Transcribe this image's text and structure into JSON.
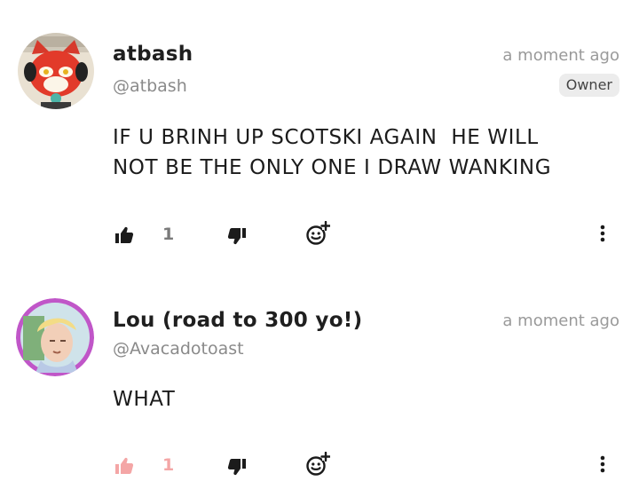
{
  "comments": [
    {
      "author": "atbash",
      "handle": "@atbash",
      "time": "a moment ago",
      "badge": "Owner",
      "text": "IF U BRINH UP SCOTSKI AGAIN  HE WILL\nNOT BE THE ONLY ONE I DRAW WANKING",
      "likes": "1",
      "liked": false,
      "avatar_icon": "red-cat-avatar"
    },
    {
      "author": "Lou (road to 300 yo!)",
      "handle": "@Avacadotoast",
      "time": "a moment ago",
      "text": "WHAT",
      "likes": "1",
      "liked": true,
      "avatar_icon": "blond-person-avatar"
    }
  ],
  "icons": {
    "like": "thumbs-up-icon",
    "dislike": "thumbs-down-icon",
    "react": "add-emoji-icon",
    "more": "more-vertical-icon"
  },
  "colors": {
    "liked": "#f4a6a6",
    "muted": "#9a9a9a"
  }
}
